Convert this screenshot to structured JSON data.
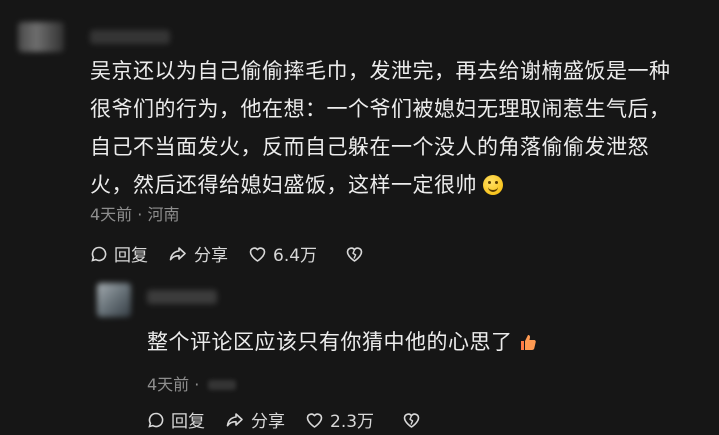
{
  "main_comment": {
    "text_lines": [
      "吴京还以为自己偷偷摔毛巾，发泄完，再去给谢楠盛饭是一种",
      "很爷们的行为，他在想：一个爷们被媳妇无理取闹惹生气后，",
      "自己不当面发火，反而自己躲在一个没人的角落偷偷发泄怒",
      "火，然后还得给媳妇盛饭，这样一定很帅"
    ],
    "time": "4天前",
    "separator": "·",
    "location": "河南",
    "reply_label": "回复",
    "share_label": "分享",
    "likes": "6.4万"
  },
  "reply_comment": {
    "text": "整个评论区应该只有你猜中他的心思了",
    "time": "4天前",
    "separator": "·",
    "reply_label": "回复",
    "share_label": "分享",
    "likes": "2.3万"
  },
  "icons": {
    "reply": "comment-bubble-icon",
    "share": "share-arrow-icon",
    "like": "heart-icon",
    "dislike": "broken-heart-icon",
    "smile": "smiling-face-emoji",
    "thumb": "thumbs-up-emoji"
  }
}
